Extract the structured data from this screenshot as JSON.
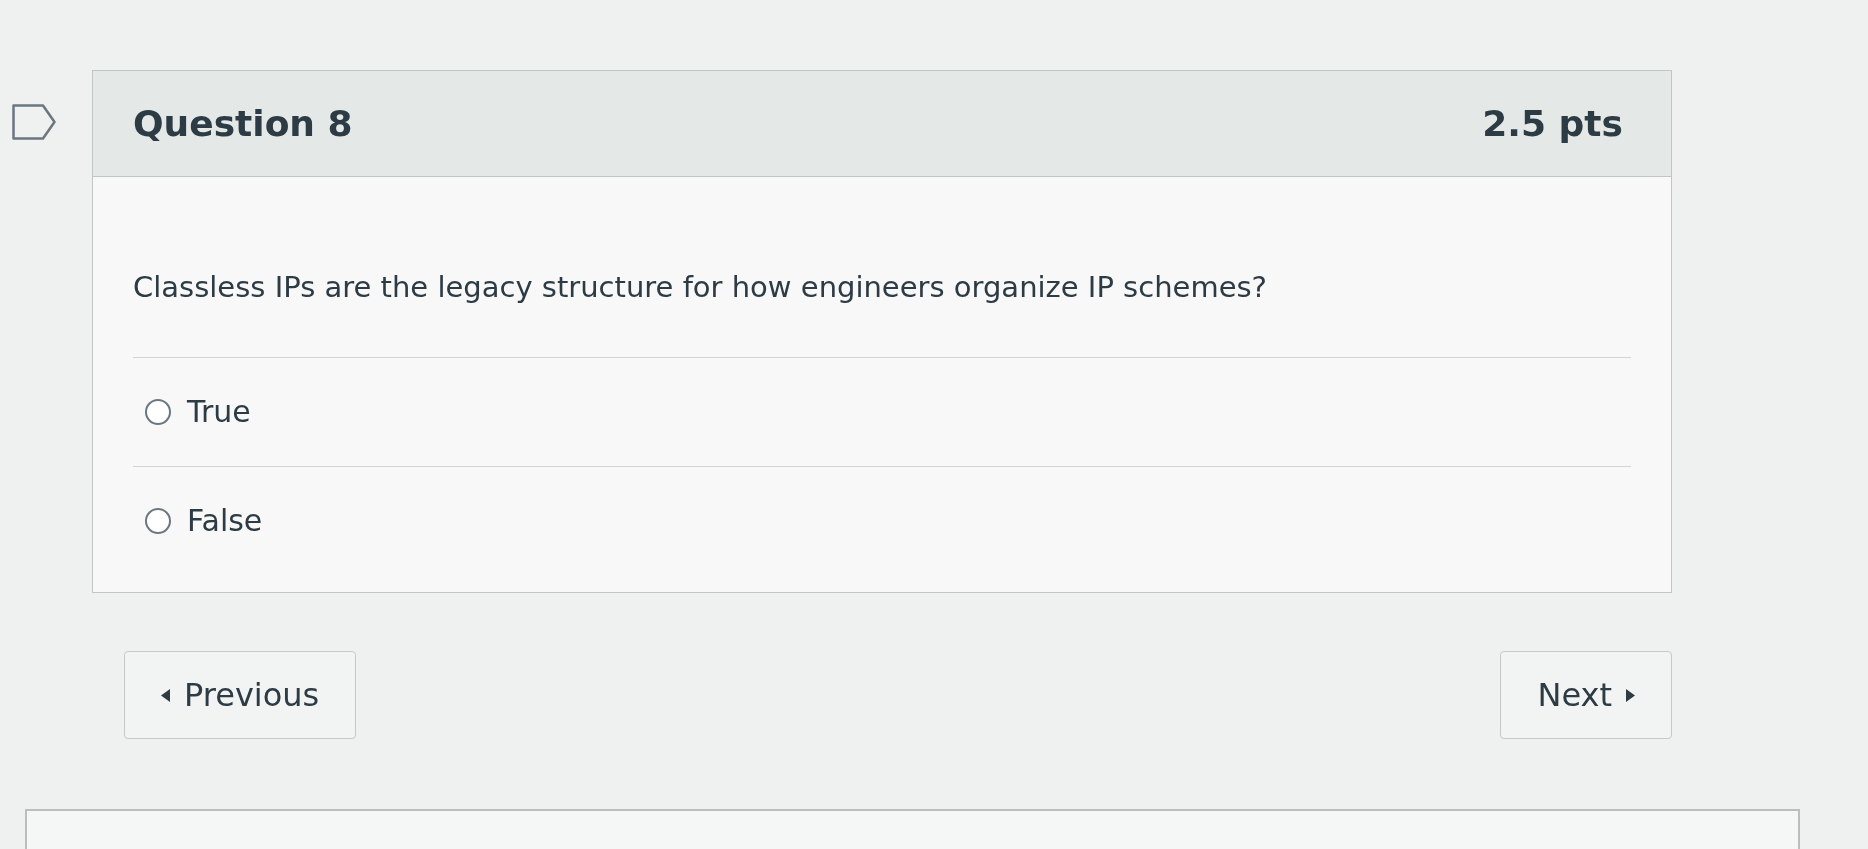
{
  "question": {
    "flagged": false,
    "title": "Question 8",
    "points": "2.5 pts",
    "text": "Classless IPs are the legacy structure for how engineers organize IP schemes?",
    "answers": [
      {
        "label": "True",
        "selected": false
      },
      {
        "label": "False",
        "selected": false
      }
    ]
  },
  "navigation": [
    {
      "kind": "previous",
      "label": "Previous"
    },
    {
      "kind": "next",
      "label": "Next"
    }
  ]
}
